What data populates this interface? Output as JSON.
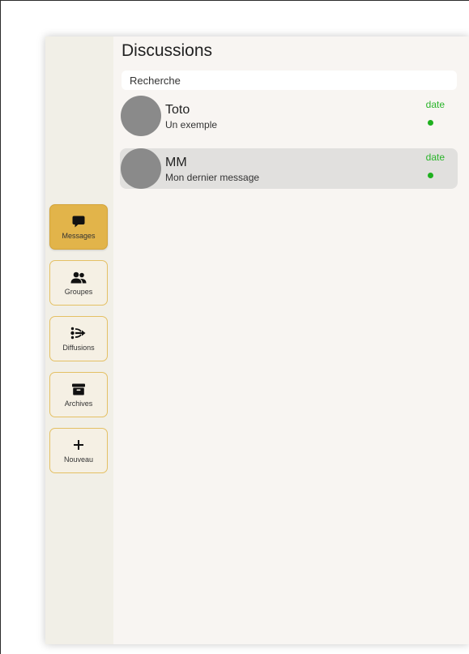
{
  "main": {
    "title": "Discussions",
    "search": {
      "placeholder": "Recherche",
      "value": ""
    },
    "conversations": [
      {
        "name": "Toto",
        "preview": "Un exemple",
        "date": "date",
        "unread": true,
        "selected": false
      },
      {
        "name": "MM",
        "preview": "Mon dernier message",
        "date": "date",
        "unread": true,
        "selected": true
      }
    ]
  },
  "sidebar": {
    "items": [
      {
        "label": "Messages",
        "icon": "chat-bubble-icon",
        "active": true
      },
      {
        "label": "Groupes",
        "icon": "users-icon",
        "active": false
      },
      {
        "label": "Diffusions",
        "icon": "broadcast-icon",
        "active": false
      },
      {
        "label": "Archives",
        "icon": "archive-box-icon",
        "active": false
      },
      {
        "label": "Nouveau",
        "icon": "plus-icon",
        "active": false
      }
    ]
  },
  "colors": {
    "accent": "#e2b44a",
    "status_green": "#1fb01f",
    "avatar_gray": "#8a8a8a"
  }
}
